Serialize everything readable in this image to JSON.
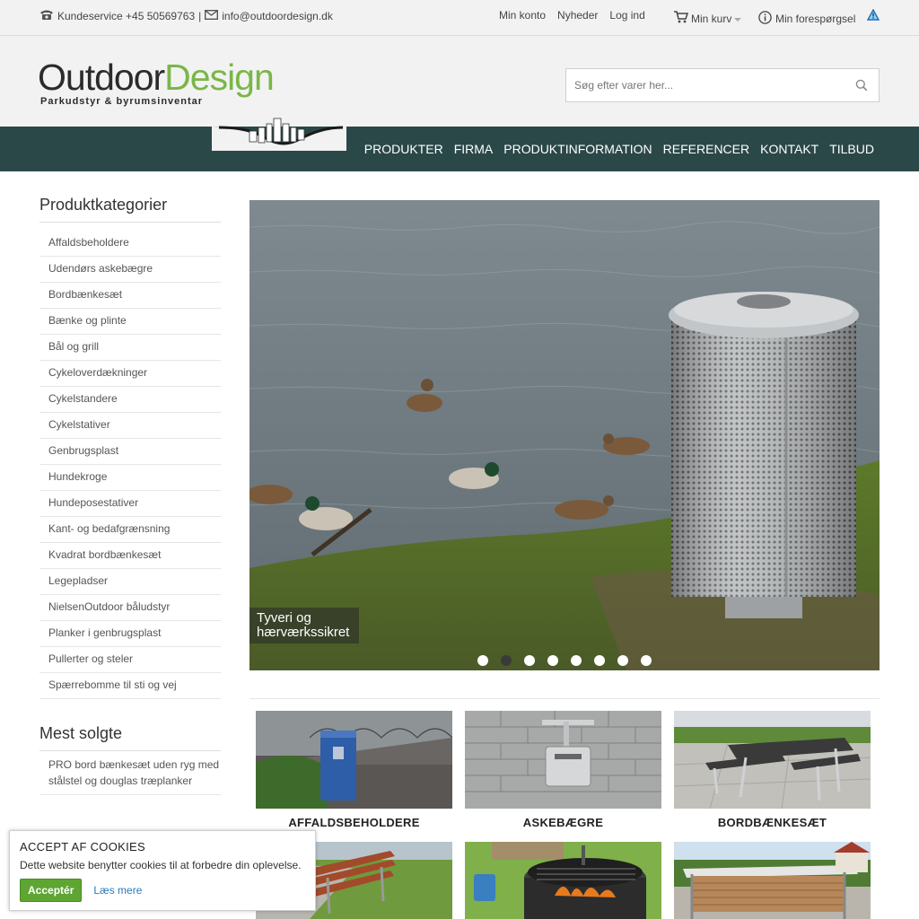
{
  "topbar": {
    "phone": "Kundeservice +45 50569763",
    "separator": "|",
    "email": "info@outdoordesign.dk",
    "links": [
      "Min konto",
      "Nyheder",
      "Log ind"
    ],
    "cart": "Min kurv",
    "inquiry": "Min forespørgsel"
  },
  "logo": {
    "word_a": "Outdoor",
    "word_b": "Design",
    "tagline": "Parkudstyr & byrumsinventar"
  },
  "search": {
    "placeholder": "Søg efter varer her..."
  },
  "nav": [
    "PRODUKTER",
    "FIRMA",
    "PRODUKTINFORMATION",
    "REFERENCER",
    "KONTAKT",
    "TILBUD"
  ],
  "sidebar": {
    "title": "Produktkategorier",
    "categories": [
      "Affaldsbeholdere",
      "Udendørs askebægre",
      "Bordbænkesæt",
      "Bænke og plinte",
      "Bål og grill",
      "Cykeloverdækninger",
      "Cykelstandere",
      "Cykelstativer",
      "Genbrugsplast",
      "Hundekroge",
      "Hundeposestativer",
      "Kant- og bedafgrænsning",
      "Kvadrat bordbænkesæt",
      "Legepladser",
      "NielsenOutdoor båludstyr",
      "Planker i genbrugsplast",
      "Pullerter og steler",
      "Spærrebomme til sti og vej"
    ],
    "best_title": "Mest solgte",
    "best_item": "PRO bord bænkesæt uden ryg med stålstel og douglas træplanker"
  },
  "slider": {
    "caption": "Tyveri og hærværkssikret",
    "dot_count": 8,
    "active_dot": 2
  },
  "tiles": [
    "AFFALDSBEHOLDERE",
    "ASKEBÆGRE",
    "BORDBÆNKESÆT"
  ],
  "cookie": {
    "title": "ACCEPT AF COOKIES",
    "text": "Dette website benytter cookies til at forbedre din oplevelse.",
    "accept": "Acceptér",
    "more": "Læs mere"
  },
  "colors": {
    "nav_bg": "#2b4848",
    "brand_green": "#7ab648",
    "accept_green": "#5ea532"
  }
}
